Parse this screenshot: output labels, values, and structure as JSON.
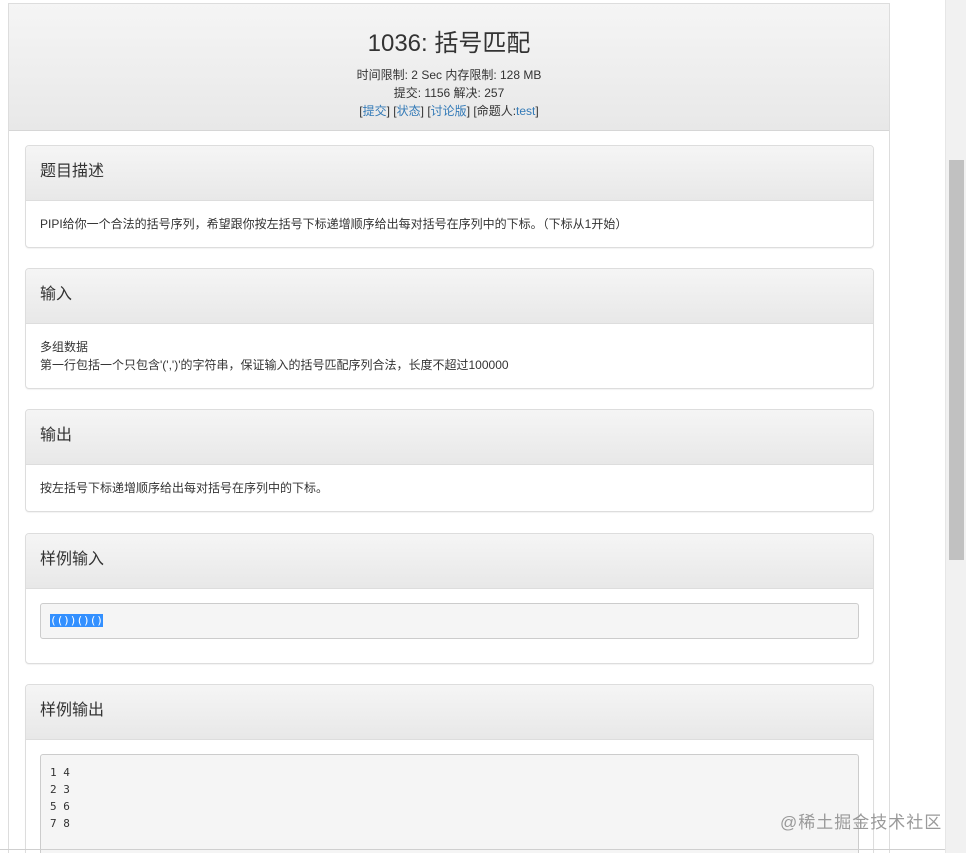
{
  "problem": {
    "title": "1036: 括号匹配",
    "limits": "时间限制: 2 Sec  内存限制: 128 MB",
    "stats": "提交: 1156  解决: 257",
    "links": {
      "submit": "提交",
      "status": "状态",
      "discuss": "讨论版",
      "author_prefix": "命题人:",
      "author": "test"
    }
  },
  "sections": {
    "description": {
      "heading": "题目描述",
      "text": "PIPI给你一个合法的括号序列，希望跟你按左括号下标递增顺序给出每对括号在序列中的下标。（下标从1开始）"
    },
    "input": {
      "heading": "输入",
      "lines": [
        "多组数据",
        "第一行包括一个只包含'(',')'的字符串，保证输入的括号匹配序列合法，长度不超过100000"
      ]
    },
    "output": {
      "heading": "输出",
      "text": "按左括号下标递增顺序给出每对括号在序列中的下标。"
    },
    "sample_input": {
      "heading": "样例输入",
      "code": "(())()()"
    },
    "sample_output": {
      "heading": "样例输出",
      "lines": [
        "1 4",
        "2 3",
        "5 6",
        "7 8"
      ]
    }
  },
  "watermark": "@稀土掘金技术社区",
  "colors": {
    "link": "#337ab7",
    "selection": "#3390ff"
  }
}
